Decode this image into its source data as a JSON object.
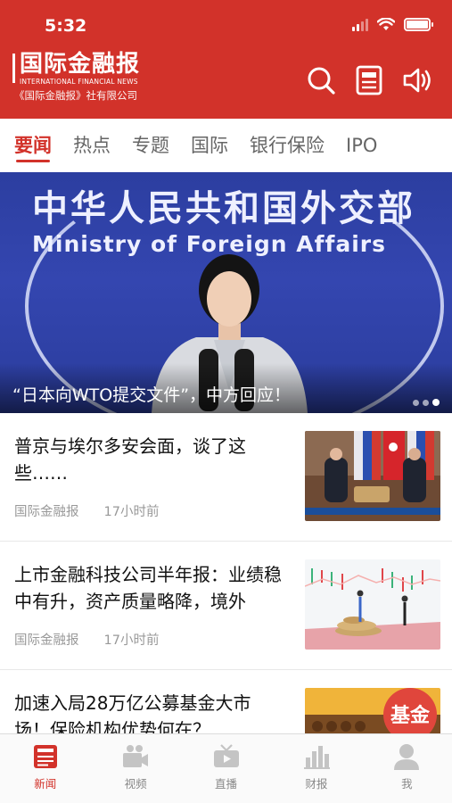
{
  "status_bar": {
    "time": "5:32"
  },
  "brand": {
    "name_cn": "国际金融报",
    "name_en": "INTERNATIONAL FINANCIAL NEWS",
    "company": "《国际金融报》社有限公司"
  },
  "header_icons": [
    "search-icon",
    "newspaper-icon",
    "speaker-icon"
  ],
  "colors": {
    "brand_red": "#d2322a",
    "meta_gray": "#999999",
    "hero_blue": "#3446b0"
  },
  "tabs": [
    {
      "label": "要闻",
      "active": true
    },
    {
      "label": "热点",
      "active": false
    },
    {
      "label": "专题",
      "active": false
    },
    {
      "label": "国际",
      "active": false
    },
    {
      "label": "银行保险",
      "active": false
    },
    {
      "label": "IPO",
      "active": false
    }
  ],
  "hero": {
    "backdrop_cn": "中华人民共和国外交部",
    "backdrop_en": "Ministry of Foreign Affairs",
    "caption": "“日本向WTO提交文件”，中方回应！",
    "slide_count": 3,
    "active_slide": 3
  },
  "news": [
    {
      "title": "普京与埃尔多安会面，谈了这些……",
      "source": "国际金融报",
      "time": "17小时前"
    },
    {
      "title": "上市金融科技公司半年报：业绩稳中有升，资产质量略降，境外",
      "source": "国际金融报",
      "time": "17小时前"
    },
    {
      "title": "加速入局28万亿公募基金大市场！保险机构优势何在？",
      "source": "",
      "time": ""
    }
  ],
  "thumb3_text": "基金",
  "bottom_nav": [
    {
      "label": "新闻",
      "icon": "news-icon",
      "active": true
    },
    {
      "label": "视频",
      "icon": "video-camera-icon",
      "active": false
    },
    {
      "label": "直播",
      "icon": "tv-icon",
      "active": false
    },
    {
      "label": "财报",
      "icon": "bar-chart-icon",
      "active": false
    },
    {
      "label": "我",
      "icon": "user-icon",
      "active": false
    }
  ]
}
